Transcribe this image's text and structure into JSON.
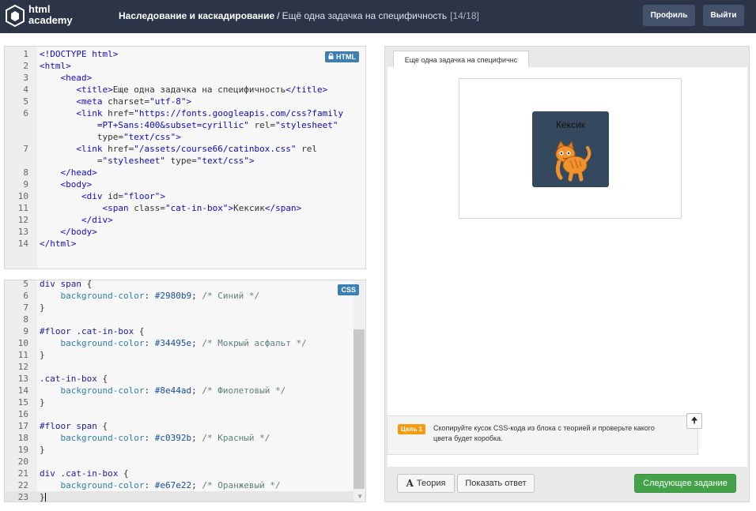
{
  "header": {
    "logo_line1": "html",
    "logo_line2": "academy",
    "course": "Наследование и каскадирование",
    "separator": "/",
    "task": "Ещё одна задачка на специфичность",
    "counter": "[14/18]",
    "profile_label": "Профиль",
    "logout_label": "Выйти"
  },
  "html_editor": {
    "badge": "HTML",
    "lines": [
      {
        "n": "1",
        "html": "<span class=\"tag\">&lt;!DOCTYPE html&gt;</span>"
      },
      {
        "n": "2",
        "html": "<span class=\"tag\">&lt;html&gt;</span>"
      },
      {
        "n": "3",
        "html": "    <span class=\"tag\">&lt;head&gt;</span>"
      },
      {
        "n": "4",
        "html": "       <span class=\"tag\">&lt;title&gt;</span>Еще одна задачка на специфичность<span class=\"tag\">&lt;/title&gt;</span>"
      },
      {
        "n": "5",
        "html": "       <span class=\"tag\">&lt;meta</span> <span class=\"attr\">charset</span>=<span class=\"str\">\"utf-8\"</span><span class=\"tag\">&gt;</span>"
      },
      {
        "n": "6",
        "html": "       <span class=\"tag\">&lt;link</span> <span class=\"attr\">href</span>=<span class=\"str\">\"https://fonts.googleapis.com/css?family</span>"
      },
      {
        "n": "",
        "html": "           <span class=\"str\">=PT+Sans:400&amp;subset=cyrillic\"</span> <span class=\"attr\">rel</span>=<span class=\"str\">\"stylesheet\"</span>"
      },
      {
        "n": "",
        "html": "           <span class=\"attr\">type</span>=<span class=\"str\">\"text/css\"</span><span class=\"tag\">&gt;</span>"
      },
      {
        "n": "7",
        "html": "       <span class=\"tag\">&lt;link</span> <span class=\"attr\">href</span>=<span class=\"str\">\"/assets/course66/catinbox.css\"</span> <span class=\"attr\">rel</span>"
      },
      {
        "n": "",
        "html": "           =<span class=\"str\">\"stylesheet\"</span> <span class=\"attr\">type</span>=<span class=\"str\">\"text/css\"</span><span class=\"tag\">&gt;</span>"
      },
      {
        "n": "8",
        "html": "    <span class=\"tag\">&lt;/head&gt;</span>"
      },
      {
        "n": "9",
        "html": "    <span class=\"tag\">&lt;body&gt;</span>"
      },
      {
        "n": "10",
        "html": "        <span class=\"tag\">&lt;div</span> <span class=\"attr\">id</span>=<span class=\"str\">\"floor\"</span><span class=\"tag\">&gt;</span>"
      },
      {
        "n": "11",
        "html": "            <span class=\"tag\">&lt;span</span> <span class=\"attr\">class</span>=<span class=\"str\">\"cat-in-box\"</span><span class=\"tag\">&gt;</span>Кексик<span class=\"tag\">&lt;/span&gt;</span>"
      },
      {
        "n": "12",
        "html": "        <span class=\"tag\">&lt;/div&gt;</span>"
      },
      {
        "n": "13",
        "html": "    <span class=\"tag\">&lt;/body&gt;</span>"
      },
      {
        "n": "14",
        "html": "<span class=\"tag\">&lt;/html&gt;</span>"
      }
    ]
  },
  "css_editor": {
    "badge": "CSS",
    "lines": [
      {
        "n": "5",
        "html": "<span class=\"sel\">div span</span> {"
      },
      {
        "n": "6",
        "html": "    <span class=\"prop\">background-color</span>: <span class=\"val\">#2980b9</span>; <span class=\"cmt\">/* Синий */</span>"
      },
      {
        "n": "7",
        "html": "}"
      },
      {
        "n": "8",
        "html": ""
      },
      {
        "n": "9",
        "html": "<span class=\"sel\">#floor .cat-in-box</span> {"
      },
      {
        "n": "10",
        "html": "    <span class=\"prop\">background-color</span>: <span class=\"val\">#34495e</span>; <span class=\"cmt\">/* Мокрый асфальт */</span>"
      },
      {
        "n": "11",
        "html": "}"
      },
      {
        "n": "12",
        "html": ""
      },
      {
        "n": "13",
        "html": "<span class=\"sel\">.cat-in-box</span> {"
      },
      {
        "n": "14",
        "html": "    <span class=\"prop\">background-color</span>: <span class=\"val\">#8e44ad</span>; <span class=\"cmt\">/* Фиолетовый */</span>"
      },
      {
        "n": "15",
        "html": "}"
      },
      {
        "n": "16",
        "html": ""
      },
      {
        "n": "17",
        "html": "<span class=\"sel\">#floor span</span> {"
      },
      {
        "n": "18",
        "html": "    <span class=\"prop\">background-color</span>: <span class=\"val\">#c0392b</span>; <span class=\"cmt\">/* Красный */</span>"
      },
      {
        "n": "19",
        "html": "}"
      },
      {
        "n": "20",
        "html": ""
      },
      {
        "n": "21",
        "html": "<span class=\"sel\">div .cat-in-box</span> {"
      },
      {
        "n": "22",
        "html": "    <span class=\"prop\">background-color</span>: <span class=\"val\">#e67e22</span>; <span class=\"cmt\">/* Оранжевый */</span>"
      },
      {
        "n": "23",
        "html": "}"
      }
    ]
  },
  "preview": {
    "tab_title": "Еще одна задачка на специфичнс",
    "cat_name": "Кексик",
    "cat_box_color": "#34495e",
    "goal_label": "Цель 1",
    "goal_text": "Скопируйте кусок CSS-кода из блока с теорией и проверьте какого цвета будет коробка.",
    "theory_label": "Теория",
    "answer_label": "Показать ответ",
    "next_label": "Следующее задание"
  }
}
